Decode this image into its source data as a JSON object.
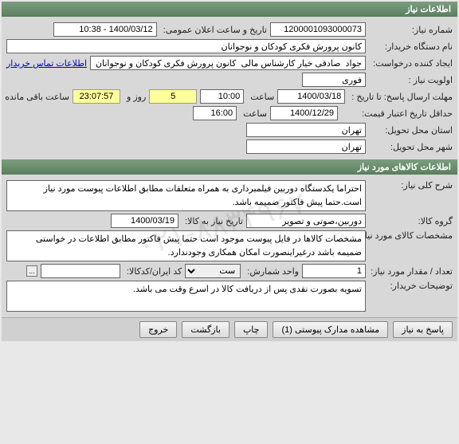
{
  "sections": {
    "info": {
      "title": "اطلاعات نیاز"
    },
    "goods": {
      "title": "اطلاعات کالاهای مورد نیاز"
    }
  },
  "info": {
    "need_no_label": "شماره نیاز:",
    "need_no": "1200001093000073",
    "public_dt_label": "تاریخ و ساعت اعلان عمومی:",
    "public_dt": "1400/03/12 - 10:38",
    "org_label": "نام دستگاه خریدار:",
    "org": "کانون پرورش فکری کودکان و نوجوانان",
    "creator_label": "ایجاد کننده درخواست:",
    "creator": "جواد  صادقی خیار کارشناس مالی  کانون پرورش فکری کودکان و نوجوانان",
    "contact_link": "اطلاعات تماس خریدار",
    "priority_label": "اولویت نیاز :",
    "priority": "فوری",
    "reply_deadline_label": "مهلت ارسال پاسخ:  تا تاریخ  :",
    "reply_date": "1400/03/18",
    "time_label": "ساعت",
    "reply_time": "10:00",
    "days": "5",
    "days_label": "روز و",
    "countdown": "23:07:57",
    "remaining_label": "ساعت باقی مانده",
    "min_validity_label": "حداقل تاریخ اعتبار قیمت:",
    "min_validity_date": "1400/12/29",
    "min_validity_time": "16:00",
    "delivery_province_label": "استان محل تحویل:",
    "delivery_province": "تهران",
    "delivery_city_label": "شهر محل تحویل:",
    "delivery_city": "تهران"
  },
  "goods": {
    "general_desc_label": "شرح کلی نیاز:",
    "general_desc": "احتراما یکدستگاه دوربین فیلمبرداری به همراه متعلقات مطابق اطلاعات پیوست مورد نیاز است.حتما پیش فاکتور ضمیمه باشد.",
    "group_label": "گروه کالا:",
    "group": "دوربین،صوتی و تصویر",
    "need_to_date_label": "تاریخ نیاز به کالا:",
    "need_to_date": "1400/03/19",
    "spec_label": "مشخصات کالای مورد نیاز:",
    "spec": "مشخصات کالاها در فایل پیوست موجود است حتما پیش فاکتور مطابق اطلاعات در خواستی ضمیمه باشد درغیراینصورت امکان همکاری وجودندارد.",
    "qty_label": "تعداد / مقدار مورد نیاز:",
    "qty": "1",
    "unit_label": "واحد شمارش:",
    "unit": "ست",
    "iran_code_label": "کد ایران/کدکالا:",
    "iran_code": "",
    "lookup": "...",
    "buyer_notes_label": "توضیحات خریدار:",
    "buyer_notes": "تسویه بصورت نقدی پس از دریافت کالا در اسرع وقت می باشد."
  },
  "buttons": {
    "respond": "پاسخ به نیاز",
    "attachments": "مشاهده مدارک پیوستی (1)",
    "print": "چاپ",
    "back": "بازگشت",
    "exit": "خروج"
  },
  "watermark": "۰۲۱-۸۸۳۴۹۶۷۰"
}
